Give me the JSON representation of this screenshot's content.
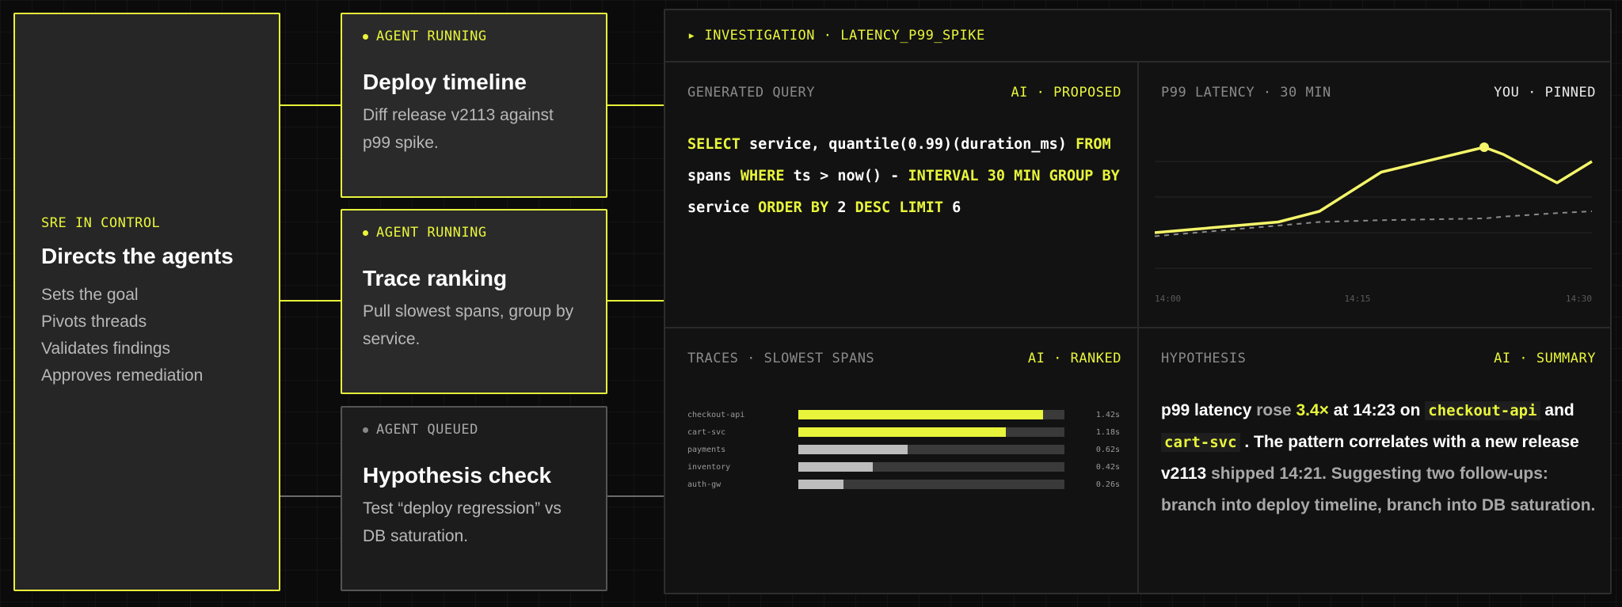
{
  "controller": {
    "eyebrow": "SRE IN CONTROL",
    "title": "Directs the agents",
    "items": [
      "Sets the goal",
      "Pivots threads",
      "Validates findings",
      "Approves remediation"
    ]
  },
  "agents": [
    {
      "status": "AGENT RUNNING",
      "title": "Deploy timeline",
      "desc": "Diff release v2113 against p99 spike."
    },
    {
      "status": "AGENT RUNNING",
      "title": "Trace ranking",
      "desc": "Pull slowest spans, group by service."
    },
    {
      "status": "AGENT QUEUED",
      "title": "Hypothesis check",
      "desc": "Test “deploy regression” vs DB saturation."
    }
  ],
  "investigation": {
    "header": "▸ INVESTIGATION · LATENCY_P99_SPIKE",
    "query": {
      "label": "GENERATED QUERY",
      "tag": "AI · PROPOSED",
      "tokens": {
        "select": "SELECT",
        "cols": " service, quantile(0.99)(duration_ms) ",
        "from": "FROM",
        "table": "spans ",
        "where": "WHERE",
        "cond": "  ts > now() - ",
        "interval": "INTERVAL 30  MIN",
        "group": " GROUP BY",
        "svc": " service ",
        "order": "ORDER BY",
        "n2": " 2 ",
        "desc": " DESC LIMIT",
        "n6": "  6"
      }
    },
    "latency": {
      "label": "P99 LATENCY · 30 MIN",
      "tag": "YOU · PINNED",
      "ticks": [
        "14:00",
        "14:15",
        "14:30"
      ]
    },
    "traces": {
      "label": "TRACES · SLOWEST SPANS",
      "tag": "AI · RANKED",
      "rows": [
        {
          "service": "checkout-api",
          "duration": "1.42s",
          "fraction": 0.92,
          "color": "#e8f53b"
        },
        {
          "service": "cart-svc",
          "duration": "1.18s",
          "fraction": 0.78,
          "color": "#e8f53b"
        },
        {
          "service": "payments",
          "duration": "0.62s",
          "fraction": 0.41,
          "color": "#bdbdbd"
        },
        {
          "service": "inventory",
          "duration": "0.42s",
          "fraction": 0.28,
          "color": "#bdbdbd"
        },
        {
          "service": "auth-gw",
          "duration": "0.26s",
          "fraction": 0.17,
          "color": "#bdbdbd"
        }
      ]
    },
    "hypothesis": {
      "label": "HYPOTHESIS",
      "tag": "AI · SUMMARY",
      "p1": "p99 latency",
      "p2": " rose ",
      "p3": "3.4×",
      "p4": " at 14:23 on ",
      "p5": "checkout-api",
      "p6": " and ",
      "p7": "cart-svc",
      "p8": " . The pattern correlates with a new ",
      "p9": "release v2113",
      "p10": " shipped 14:21. Suggesting two follow-ups: branch into deploy timeline, branch into DB saturation."
    }
  },
  "chart_data": {
    "type": "line",
    "x": [
      "14:00",
      "14:05",
      "14:10",
      "14:15",
      "14:18",
      "14:21",
      "14:23",
      "14:25",
      "14:28",
      "14:30"
    ],
    "series": [
      {
        "values": [
          1.0,
          1.1,
          1.2,
          1.3,
          1.6,
          2.7,
          3.4,
          3.2,
          2.4,
          3.0
        ],
        "color": "#f4f56a"
      },
      {
        "values": [
          0.9,
          1.0,
          1.1,
          1.2,
          1.3,
          1.35,
          1.4,
          1.45,
          1.55,
          1.6
        ],
        "color": "#8a8a8a",
        "dashed": true
      }
    ],
    "highlight_index": 6,
    "ylim": [
      0,
      4
    ],
    "grid": true
  }
}
